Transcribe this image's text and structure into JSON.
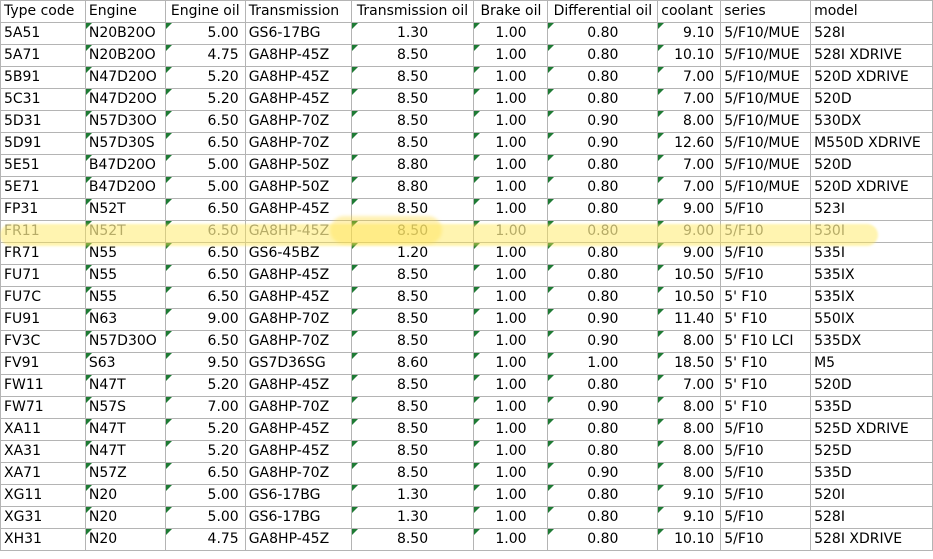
{
  "headers": [
    "Type code",
    "Engine",
    "Engine oil",
    "Transmission",
    "Transmission oil",
    "Brake oil",
    "Differential oil",
    "coolant",
    "series",
    "model"
  ],
  "rows": [
    [
      "5A51",
      "N20B20O",
      "5.00",
      "GS6-17BG",
      "1.30",
      "1.00",
      "0.80",
      "9.10",
      "5/F10/MUE",
      "528I"
    ],
    [
      "5A71",
      "N20B20O",
      "4.75",
      "GA8HP-45Z",
      "8.50",
      "1.00",
      "0.80",
      "10.10",
      "5/F10/MUE",
      "528I XDRIVE"
    ],
    [
      "5B91",
      "N47D20O",
      "5.20",
      "GA8HP-45Z",
      "8.50",
      "1.00",
      "0.80",
      "7.00",
      "5/F10/MUE",
      "520D XDRIVE"
    ],
    [
      "5C31",
      "N47D20O",
      "5.20",
      "GA8HP-45Z",
      "8.50",
      "1.00",
      "0.80",
      "7.00",
      "5/F10/MUE",
      "520D"
    ],
    [
      "5D31",
      "N57D30O",
      "6.50",
      "GA8HP-70Z",
      "8.50",
      "1.00",
      "0.90",
      "8.00",
      "5/F10/MUE",
      "530DX"
    ],
    [
      "5D91",
      "N57D30S",
      "6.50",
      "GA8HP-70Z",
      "8.50",
      "1.00",
      "0.90",
      "12.60",
      "5/F10/MUE",
      "M550D XDRIVE"
    ],
    [
      "5E51",
      "B47D20O",
      "5.00",
      "GA8HP-50Z",
      "8.80",
      "1.00",
      "0.80",
      "7.00",
      "5/F10/MUE",
      "520D"
    ],
    [
      "5E71",
      "B47D20O",
      "5.00",
      "GA8HP-50Z",
      "8.80",
      "1.00",
      "0.80",
      "7.00",
      "5/F10/MUE",
      "520D XDRIVE"
    ],
    [
      "FP31",
      "N52T",
      "6.50",
      "GA8HP-45Z",
      "8.50",
      "1.00",
      "0.80",
      "9.00",
      "5/F10",
      "523I"
    ],
    [
      "FR11",
      "N52T",
      "6.50",
      "GA8HP-45Z",
      "8.50",
      "1.00",
      "0.80",
      "9.00",
      "5/F10",
      "530I"
    ],
    [
      "FR71",
      "N55",
      "6.50",
      "GS6-45BZ",
      "1.20",
      "1.00",
      "0.80",
      "9.00",
      "5/F10",
      "535I"
    ],
    [
      "FU71",
      "N55",
      "6.50",
      "GA8HP-45Z",
      "8.50",
      "1.00",
      "0.80",
      "10.50",
      "5/F10",
      "535IX"
    ],
    [
      "FU7C",
      "N55",
      "6.50",
      "GA8HP-45Z",
      "8.50",
      "1.00",
      "0.80",
      "10.50",
      "5' F10",
      "535IX"
    ],
    [
      "FU91",
      "N63",
      "9.00",
      "GA8HP-70Z",
      "8.50",
      "1.00",
      "0.90",
      "11.40",
      "5' F10",
      "550IX"
    ],
    [
      "FV3C",
      "N57D30O",
      "6.50",
      "GA8HP-70Z",
      "8.50",
      "1.00",
      "0.90",
      "8.00",
      "5' F10 LCI",
      "535DX"
    ],
    [
      "FV91",
      "S63",
      "9.50",
      "GS7D36SG",
      "8.60",
      "1.00",
      "1.00",
      "18.50",
      "5' F10",
      "M5"
    ],
    [
      "FW11",
      "N47T",
      "5.20",
      "GA8HP-45Z",
      "8.50",
      "1.00",
      "0.80",
      "7.00",
      "5' F10",
      "520D"
    ],
    [
      "FW71",
      "N57S",
      "7.00",
      "GA8HP-70Z",
      "8.50",
      "1.00",
      "0.90",
      "8.00",
      "5' F10",
      "535D"
    ],
    [
      "XA11",
      "N47T",
      "5.20",
      "GA8HP-45Z",
      "8.50",
      "1.00",
      "0.80",
      "8.00",
      "5/F10",
      "525D XDRIVE"
    ],
    [
      "XA31",
      "N47T",
      "5.20",
      "GA8HP-45Z",
      "8.50",
      "1.00",
      "0.80",
      "8.00",
      "5/F10",
      "525D"
    ],
    [
      "XA71",
      "N57Z",
      "6.50",
      "GA8HP-70Z",
      "8.50",
      "1.00",
      "0.90",
      "8.00",
      "5/F10",
      "535D"
    ],
    [
      "XG11",
      "N20",
      "5.00",
      "GS6-17BG",
      "1.30",
      "1.00",
      "0.80",
      "9.10",
      "5/F10",
      "520I"
    ],
    [
      "XG31",
      "N20",
      "5.00",
      "GS6-17BG",
      "1.30",
      "1.00",
      "0.80",
      "9.10",
      "5/F10",
      "528I"
    ],
    [
      "XH31",
      "N20",
      "4.75",
      "GA8HP-45Z",
      "8.50",
      "1.00",
      "0.80",
      "10.10",
      "5/F10",
      "528I XDRIVE"
    ]
  ],
  "highlighted_row_index": 9,
  "colors": {
    "grid": "#b4b4b4",
    "highlight": "#ffe650",
    "error_flag": "#1e7b34"
  }
}
